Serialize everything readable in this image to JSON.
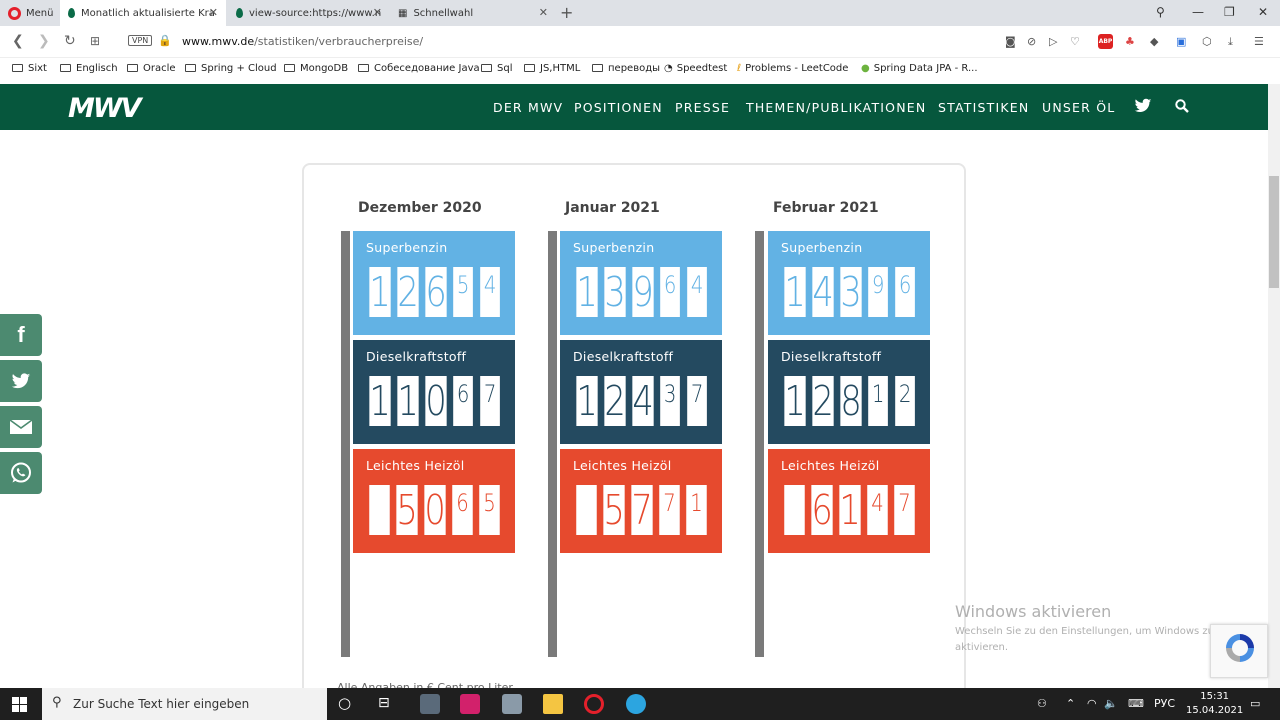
{
  "browser": {
    "menu_label": "Menü",
    "tabs": [
      {
        "title": "Monatlich aktualisierte Kra"
      },
      {
        "title": "view-source:https://www.n"
      },
      {
        "title": "Schnellwahl"
      }
    ],
    "vpn_label": "VPN",
    "url_host": "www.mwv.de",
    "url_path": "/statistiken/verbraucherpreise/",
    "bookmarks": [
      "Sixt",
      "Englisch",
      "Oracle",
      "Spring + Cloud",
      "MongoDB",
      "Собеседование Java",
      "Sql",
      "JS,HTML",
      "переводы",
      "Speedtest",
      "Problems - LeetCode",
      "Spring Data JPA - R..."
    ],
    "abp_label": "ABP"
  },
  "site": {
    "logo": "MWV",
    "nav": [
      "DER MWV",
      "POSITIONEN",
      "PRESSE",
      "THEMEN/PUBLIKATIONEN",
      "STATISTIKEN",
      "UNSER ÖL"
    ],
    "share": [
      {
        "icon": "facebook-icon",
        "glyph": "f"
      },
      {
        "icon": "twitter-icon",
        "glyph": ""
      },
      {
        "icon": "mail-icon",
        "glyph": ""
      },
      {
        "icon": "whatsapp-icon",
        "glyph": ""
      }
    ]
  },
  "prices": {
    "months": [
      {
        "label": "Dezember 2020",
        "fuels": [
          {
            "name": "Superbenzin",
            "digits": [
              "1",
              "2",
              "6",
              "5",
              "4"
            ]
          },
          {
            "name": "Dieselkraftstoff",
            "digits": [
              "1",
              "1",
              "0",
              "6",
              "7"
            ]
          },
          {
            "name": "Leichtes Heizöl",
            "digits": [
              "",
              "5",
              "0",
              "6",
              "5"
            ]
          }
        ]
      },
      {
        "label": "Januar 2021",
        "fuels": [
          {
            "name": "Superbenzin",
            "digits": [
              "1",
              "3",
              "9",
              "6",
              "4"
            ]
          },
          {
            "name": "Dieselkraftstoff",
            "digits": [
              "1",
              "2",
              "4",
              "3",
              "7"
            ]
          },
          {
            "name": "Leichtes Heizöl",
            "digits": [
              "",
              "5",
              "7",
              "7",
              "1"
            ]
          }
        ]
      },
      {
        "label": "Februar 2021",
        "fuels": [
          {
            "name": "Superbenzin",
            "digits": [
              "1",
              "4",
              "3",
              "9",
              "6"
            ]
          },
          {
            "name": "Dieselkraftstoff",
            "digits": [
              "1",
              "2",
              "8",
              "1",
              "2"
            ]
          },
          {
            "name": "Leichtes Heizöl",
            "digits": [
              "",
              "6",
              "1",
              "4",
              "7"
            ]
          }
        ]
      }
    ],
    "colors": {
      "superbenzin": "#62b2e4",
      "diesel": "#244a60",
      "heizoel": "#e64a2e"
    },
    "footnote": "Alle Angaben in € Cent pro Liter"
  },
  "watermark": {
    "title": "Windows aktivieren",
    "subtitle": "Wechseln Sie zu den Einstellungen, um Windows zu aktivieren."
  },
  "taskbar": {
    "search_placeholder": "Zur Suche Text hier eingeben",
    "lang": "РУС",
    "time": "15:31",
    "date": "15.04.2021"
  }
}
